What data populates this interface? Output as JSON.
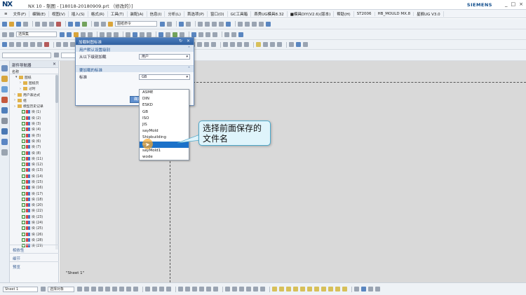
{
  "titlebar": {
    "logo": "NX",
    "title": "NX 10 - 制图 - [18018-20180909.prt （修改的）]",
    "brand": "SIEMENS",
    "controls": [
      "_",
      "□",
      "×"
    ]
  },
  "menubar": {
    "items": [
      "≡",
      "文件(F)",
      "编辑(E)",
      "视图(V)",
      "插入(S)",
      "格式(R)",
      "工具(T)",
      "装配(A)",
      "信息(I)",
      "分析(L)",
      "首选项(P)",
      "窗口(O)",
      "GC工具箱",
      "燕秀UG模具8.32",
      "■模具DIY(V2.6)(版本)",
      "帮助(H)",
      "ST2006",
      "HB_MOULD MX.8",
      "星枫UG V3.0"
    ]
  },
  "toolbar1": {
    "dwg_combo": "图纸命令"
  },
  "toolbar2": {
    "combo": "选择集"
  },
  "navigator": {
    "title": "部件导航器",
    "col_header": "名称",
    "tree": [
      {
        "label": "图纸",
        "kind": "folder"
      },
      {
        "label": "图纸页",
        "kind": "folder"
      },
      {
        "label": "过时",
        "kind": "folder"
      },
      {
        "label": "用户表达式",
        "kind": "folder"
      },
      {
        "label": "组",
        "kind": "folder"
      },
      {
        "label": "模型历史记录",
        "kind": "folder"
      },
      {
        "label": "块 (1)",
        "kind": "model"
      },
      {
        "label": "块 (2)",
        "kind": "model"
      },
      {
        "label": "块 (3)",
        "kind": "model"
      },
      {
        "label": "块 (4)",
        "kind": "model"
      },
      {
        "label": "块 (5)",
        "kind": "model"
      },
      {
        "label": "块 (6)",
        "kind": "model"
      },
      {
        "label": "块 (7)",
        "kind": "model"
      },
      {
        "label": "块 (8)",
        "kind": "model"
      },
      {
        "label": "块 (11)",
        "kind": "model"
      },
      {
        "label": "块 (12)",
        "kind": "model"
      },
      {
        "label": "块 (13)",
        "kind": "model"
      },
      {
        "label": "块 (14)",
        "kind": "model"
      },
      {
        "label": "块 (15)",
        "kind": "model"
      },
      {
        "label": "块 (16)",
        "kind": "model"
      },
      {
        "label": "块 (17)",
        "kind": "model"
      },
      {
        "label": "块 (18)",
        "kind": "model"
      },
      {
        "label": "块 (20)",
        "kind": "model"
      },
      {
        "label": "块 (22)",
        "kind": "model"
      },
      {
        "label": "块 (23)",
        "kind": "model"
      },
      {
        "label": "块 (24)",
        "kind": "model"
      },
      {
        "label": "块 (25)",
        "kind": "model"
      },
      {
        "label": "块 (26)",
        "kind": "model"
      },
      {
        "label": "块 (28)",
        "kind": "model"
      },
      {
        "label": "块 (29)",
        "kind": "model"
      }
    ],
    "footer": [
      "相依性",
      "细节",
      "预览"
    ]
  },
  "dialog": {
    "title": "加载制图标准",
    "title_icons": "↻ ×",
    "group1": {
      "title": "用户默认设置级别",
      "field_label": "从以下级别加载",
      "field_value": "用户"
    },
    "group2": {
      "title": "要加载的标准",
      "field_label": "标准",
      "field_value": "GB"
    },
    "ok_label": "确定"
  },
  "dropdown": {
    "options": [
      "ASME",
      "DIN",
      "ESKD",
      "GB",
      "ISO",
      "JIS",
      "sayMold",
      "Shipbuilding",
      "say",
      "sayMold1",
      "wode"
    ],
    "highlighted_index": 8
  },
  "canvas": {
    "sheet_label": "\"Sheet 1\""
  },
  "callout": {
    "text": "选择前面保存的文件名"
  },
  "bottombar": {
    "sheet_combo": "Sheet 1",
    "select_hint": "选择对象"
  },
  "colors": {
    "accent": "#2f5f9f",
    "highlight": "#1b71c9",
    "canvas": "#d9d9d9",
    "callout_bg": "#dff4fb",
    "callout_border": "#4da7c9"
  }
}
